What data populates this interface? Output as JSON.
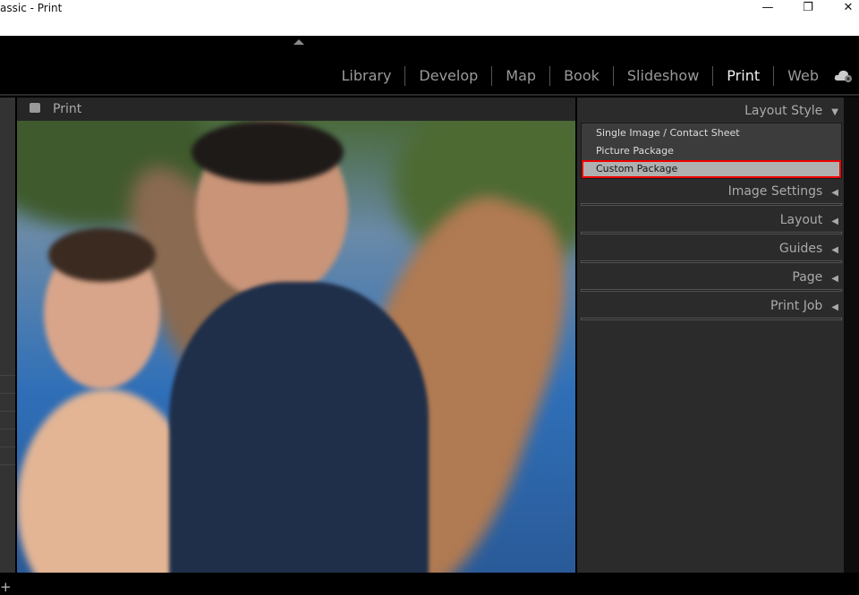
{
  "window": {
    "title": "assic - Print",
    "minimize": "—",
    "restore": "❐",
    "close": "✕"
  },
  "modules": [
    {
      "label": "Library"
    },
    {
      "label": "Develop"
    },
    {
      "label": "Map"
    },
    {
      "label": "Book"
    },
    {
      "label": "Slideshow"
    },
    {
      "label": "Print",
      "active": true
    },
    {
      "label": "Web"
    }
  ],
  "center": {
    "header": "Print"
  },
  "right": {
    "layout_style": "Layout Style",
    "styles": [
      "Single Image / Contact Sheet",
      "Picture Package",
      "Custom Package"
    ],
    "selected_style": "Custom Package",
    "panels": [
      "Image Settings",
      "Layout",
      "Guides",
      "Page",
      "Print Job"
    ],
    "expanded_arrow": "▼",
    "collapsed_arrow": "◀"
  },
  "left": {
    "add": "+"
  },
  "colors": {
    "highlight": "#e00000",
    "active_module": "#f0f0f0"
  }
}
